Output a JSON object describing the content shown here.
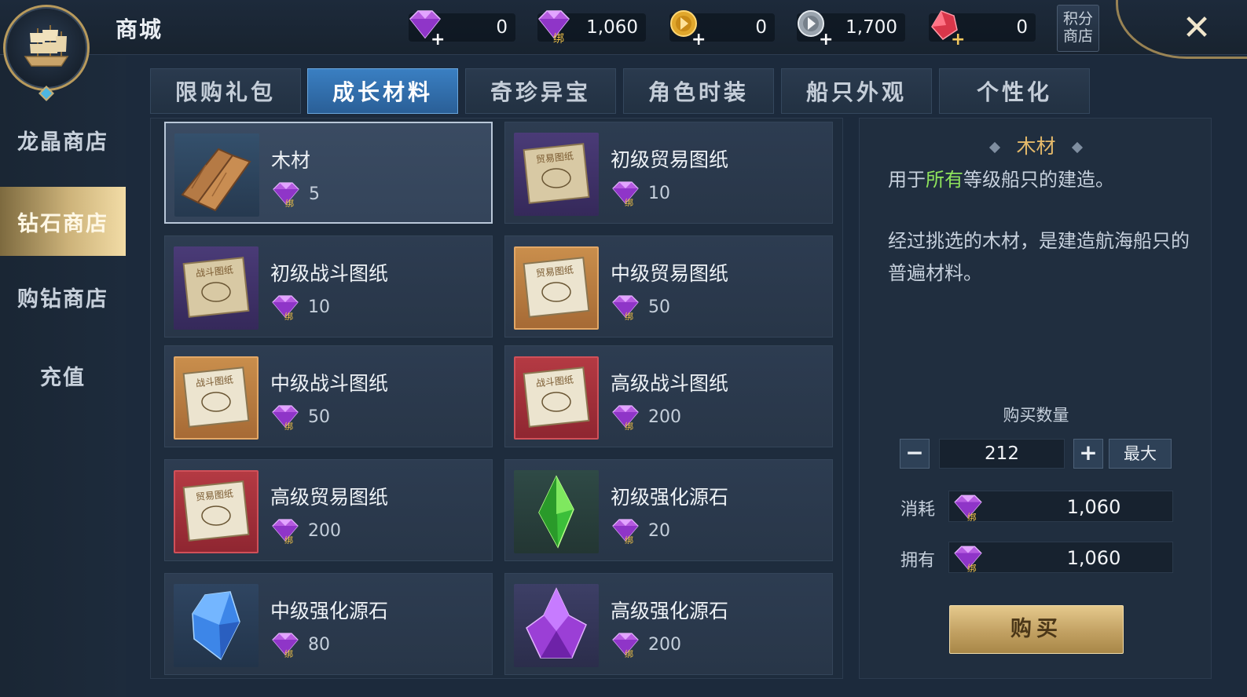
{
  "header": {
    "title": "商城",
    "currencies": [
      {
        "icon": "purple-diamond-icon",
        "value": "0"
      },
      {
        "icon": "bound-diamond-icon",
        "value": "1,060",
        "badge": "绑"
      },
      {
        "icon": "gold-coin-icon",
        "value": "0"
      },
      {
        "icon": "silver-coin-icon",
        "value": "1,700"
      },
      {
        "icon": "red-crystal-icon",
        "value": "0"
      }
    ],
    "points_shop": "积分\n商店",
    "close_icon": "close-icon"
  },
  "sidebar": {
    "items": [
      {
        "label": "龙晶商店"
      },
      {
        "label": "钻石商店"
      },
      {
        "label": "购钻商店"
      },
      {
        "label": "充值"
      }
    ]
  },
  "tabs": [
    {
      "label": "限购礼包"
    },
    {
      "label": "成长材料"
    },
    {
      "label": "奇珍异宝"
    },
    {
      "label": "角色时装"
    },
    {
      "label": "船只外观"
    },
    {
      "label": "个性化"
    }
  ],
  "items": [
    {
      "name": "木材",
      "price": "5",
      "thumb": "wood-planks-icon"
    },
    {
      "name": "初级贸易图纸",
      "price": "10",
      "thumb": "trade-blueprint-icon",
      "stamp": "贸易图纸"
    },
    {
      "name": "初级战斗图纸",
      "price": "10",
      "thumb": "battle-blueprint-icon",
      "stamp": "战斗图纸"
    },
    {
      "name": "中级贸易图纸",
      "price": "50",
      "thumb": "trade-blueprint-icon",
      "stamp": "贸易图纸"
    },
    {
      "name": "中级战斗图纸",
      "price": "50",
      "thumb": "battle-blueprint-icon",
      "stamp": "战斗图纸"
    },
    {
      "name": "高级战斗图纸",
      "price": "200",
      "thumb": "battle-blueprint-icon",
      "stamp": "战斗图纸"
    },
    {
      "name": "高级贸易图纸",
      "price": "200",
      "thumb": "trade-blueprint-icon",
      "stamp": "贸易图纸"
    },
    {
      "name": "初级强化源石",
      "price": "20",
      "thumb": "green-crystal-icon"
    },
    {
      "name": "中级强化源石",
      "price": "80",
      "thumb": "blue-crystal-icon"
    },
    {
      "name": "高级强化源石",
      "price": "200",
      "thumb": "purple-crystal-icon"
    }
  ],
  "detail": {
    "title": "木材",
    "line1_pre": "用于",
    "line1_hl": "所有",
    "line1_post": "等级船只的建造。",
    "desc": "经过挑选的木材，是建造航海船只的普遍材料。",
    "qty_label": "购买数量",
    "qty_value": "212",
    "max_label": "最大",
    "cost_label": "消耗",
    "cost_value": "1,060",
    "own_label": "拥有",
    "own_value": "1,060",
    "buy_label": "购买"
  },
  "colors": {
    "accent_gold": "#e4b96a",
    "highlight_green": "#8fe45c",
    "tab_active": "#3a7fc2"
  }
}
